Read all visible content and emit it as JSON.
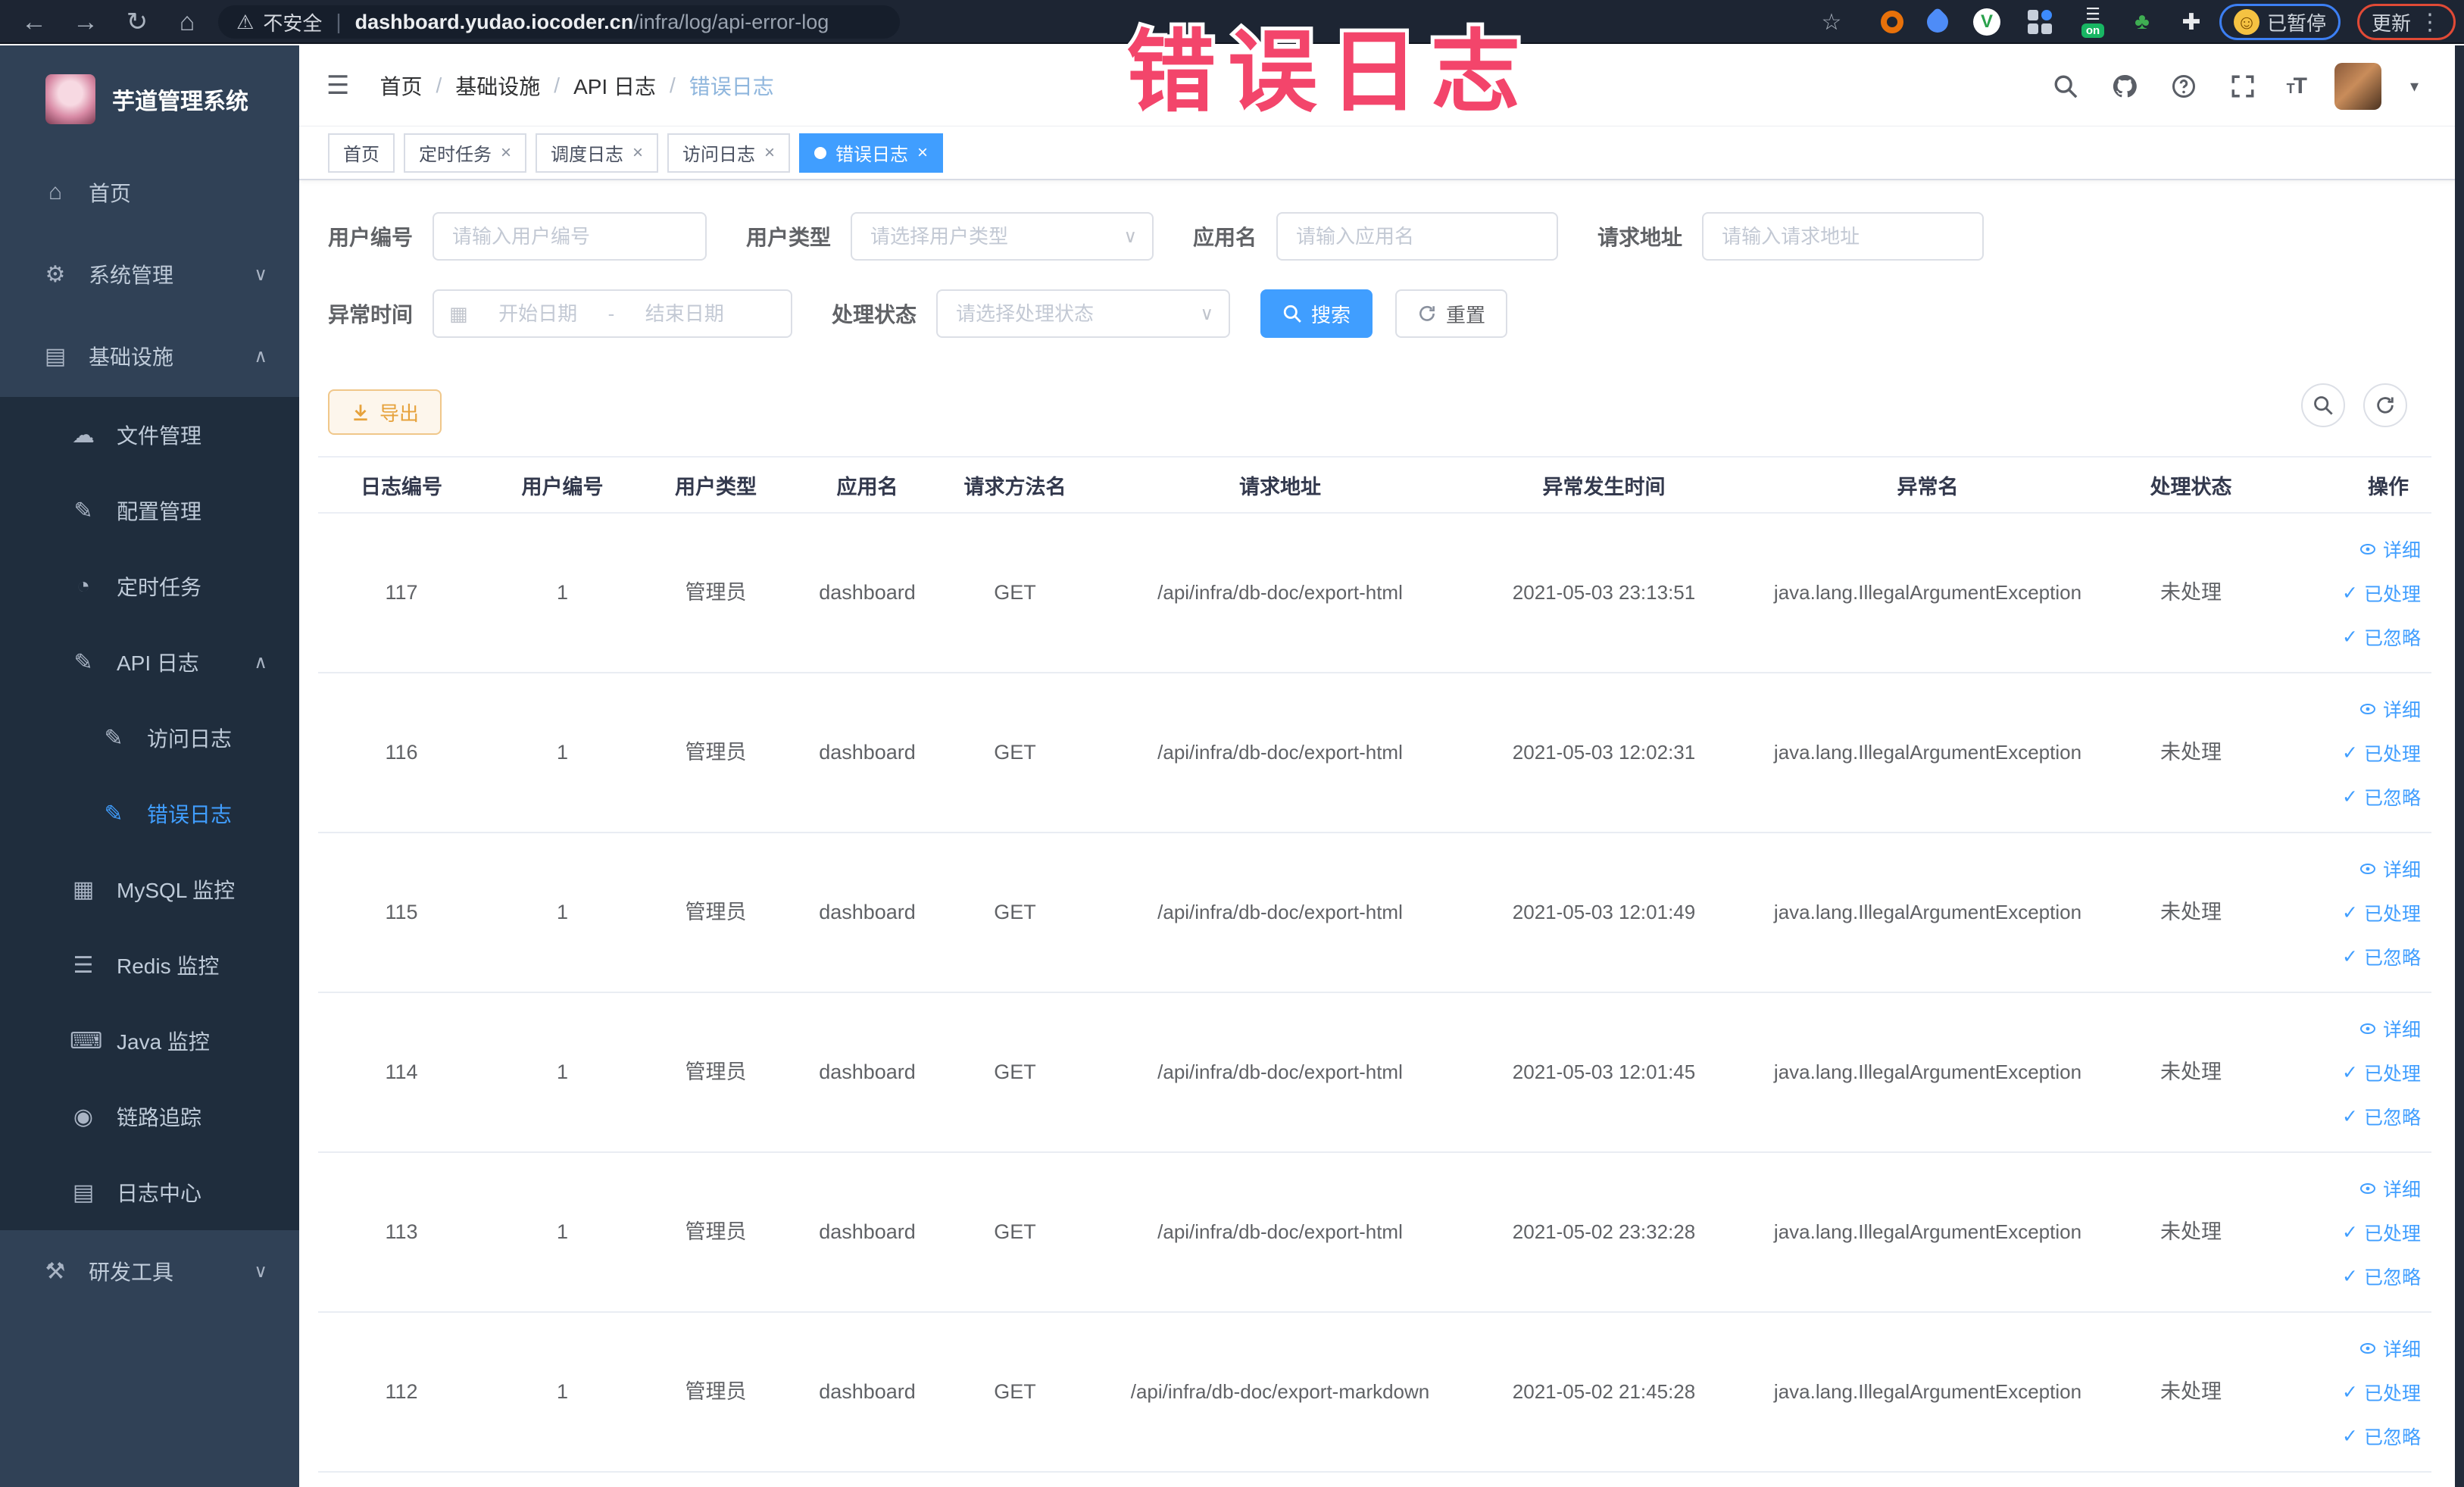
{
  "browser": {
    "security_label": "不安全",
    "url_domain": "dashboard.yudao.iocoder.cn",
    "url_path": "/infra/log/api-error-log",
    "paused_badge": "已暂停",
    "update_badge": "更新",
    "extension_on_badge": "on",
    "extension_v_letter": "V"
  },
  "watermark": "错误日志",
  "icons": {
    "back": "←",
    "forward": "→",
    "reload": "↻",
    "home": "⌂",
    "star": "☆",
    "warning": "⚠",
    "separator": "|",
    "kebab": "⋮",
    "hamburger": "☰",
    "caret_down": "▾",
    "chevron_down": "∨",
    "chevron_up": "∧",
    "close": "×",
    "check": "✓",
    "crumb_sep": "/",
    "calendar": "▦",
    "download": "↓",
    "leaf": "♣",
    "puzzle": "✚",
    "lines": "☰",
    "face": "☺",
    "font_big": "T",
    "font_small": "T"
  },
  "sidebar": {
    "title": "芋道管理系统",
    "items": [
      {
        "label": "首页",
        "glyph": "⌂"
      },
      {
        "label": "系统管理",
        "glyph": "⚙"
      },
      {
        "label": "基础设施",
        "glyph": "▤"
      },
      {
        "label": "文件管理",
        "glyph": "☁"
      },
      {
        "label": "配置管理",
        "glyph": "✎"
      },
      {
        "label": "定时任务",
        "glyph": "◔"
      },
      {
        "label": "API 日志",
        "glyph": "✎"
      },
      {
        "label": "访问日志",
        "glyph": "✎"
      },
      {
        "label": "错误日志",
        "glyph": "✎"
      },
      {
        "label": "MySQL 监控",
        "glyph": "▦"
      },
      {
        "label": "Redis 监控",
        "glyph": "☰"
      },
      {
        "label": "Java 监控",
        "glyph": "⌨"
      },
      {
        "label": "链路追踪",
        "glyph": "◉"
      },
      {
        "label": "日志中心",
        "glyph": "▤"
      },
      {
        "label": "研发工具",
        "glyph": "⚒"
      }
    ]
  },
  "header": {
    "breadcrumb": [
      "首页",
      "基础设施",
      "API 日志",
      "错误日志"
    ]
  },
  "tabs": [
    {
      "label": "首页"
    },
    {
      "label": "定时任务"
    },
    {
      "label": "调度日志"
    },
    {
      "label": "访问日志"
    },
    {
      "label": "错误日志"
    }
  ],
  "filters": {
    "user_id_label": "用户编号",
    "user_id_placeholder": "请输入用户编号",
    "user_type_label": "用户类型",
    "user_type_placeholder": "请选择用户类型",
    "app_name_label": "应用名",
    "app_name_placeholder": "请输入应用名",
    "request_url_label": "请求地址",
    "request_url_placeholder": "请输入请求地址",
    "exception_time_label": "异常时间",
    "date_start_placeholder": "开始日期",
    "date_separator": "-",
    "date_end_placeholder": "结束日期",
    "process_status_label": "处理状态",
    "process_status_placeholder": "请选择处理状态",
    "search_button": "搜索",
    "reset_button": "重置"
  },
  "toolbar": {
    "export_button": "导出"
  },
  "table": {
    "columns": [
      "日志编号",
      "用户编号",
      "用户类型",
      "应用名",
      "请求方法名",
      "请求地址",
      "异常发生时间",
      "异常名",
      "处理状态",
      "操作"
    ],
    "rows": [
      {
        "id": "117",
        "user_id": "1",
        "user_type": "管理员",
        "app_name": "dashboard",
        "method": "GET",
        "url": "/api/infra/db-doc/export-html",
        "time": "2021-05-03 23:13:51",
        "exception": "java.lang.IllegalArgumentException",
        "status": "未处理"
      },
      {
        "id": "116",
        "user_id": "1",
        "user_type": "管理员",
        "app_name": "dashboard",
        "method": "GET",
        "url": "/api/infra/db-doc/export-html",
        "time": "2021-05-03 12:02:31",
        "exception": "java.lang.IllegalArgumentException",
        "status": "未处理"
      },
      {
        "id": "115",
        "user_id": "1",
        "user_type": "管理员",
        "app_name": "dashboard",
        "method": "GET",
        "url": "/api/infra/db-doc/export-html",
        "time": "2021-05-03 12:01:49",
        "exception": "java.lang.IllegalArgumentException",
        "status": "未处理"
      },
      {
        "id": "114",
        "user_id": "1",
        "user_type": "管理员",
        "app_name": "dashboard",
        "method": "GET",
        "url": "/api/infra/db-doc/export-html",
        "time": "2021-05-03 12:01:45",
        "exception": "java.lang.IllegalArgumentException",
        "status": "未处理"
      },
      {
        "id": "113",
        "user_id": "1",
        "user_type": "管理员",
        "app_name": "dashboard",
        "method": "GET",
        "url": "/api/infra/db-doc/export-html",
        "time": "2021-05-02 23:32:28",
        "exception": "java.lang.IllegalArgumentException",
        "status": "未处理"
      },
      {
        "id": "112",
        "user_id": "1",
        "user_type": "管理员",
        "app_name": "dashboard",
        "method": "GET",
        "url": "/api/infra/db-doc/export-markdown",
        "time": "2021-05-02 21:45:28",
        "exception": "java.lang.IllegalArgumentException",
        "status": "未处理"
      }
    ],
    "row_actions": [
      "详细",
      "已处理",
      "已忽略"
    ]
  },
  "colors": {
    "accent": "#409eff",
    "sidebar_bg": "#304156",
    "submenu_bg": "#1f2d3d",
    "warning": "#e6a23c",
    "watermark_pink": "#f3456b",
    "chrome_bg": "#1d2533"
  }
}
